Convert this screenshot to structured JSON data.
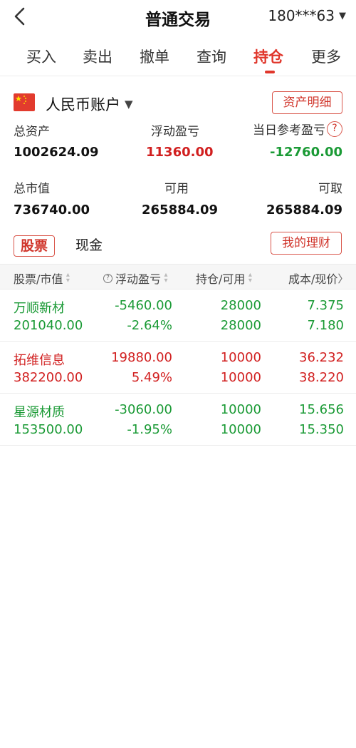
{
  "header": {
    "title": "普通交易",
    "account_masked": "180***63",
    "caret": "▼"
  },
  "tabs": [
    {
      "label": "买入"
    },
    {
      "label": "卖出"
    },
    {
      "label": "撤单"
    },
    {
      "label": "查询"
    },
    {
      "label": "持仓"
    },
    {
      "label": "更多"
    }
  ],
  "active_tab": "持仓",
  "account": {
    "currency_account": "人民币账户",
    "caret": "▼",
    "asset_detail_button": "资产明细"
  },
  "summary": {
    "total_assets_label": "总资产",
    "total_assets_value": "1002624.09",
    "floating_pl_label": "浮动盈亏",
    "floating_pl_value": "11360.00",
    "daily_ref_pl_label": "当日参考盈亏",
    "daily_ref_pl_value": "-12760.00",
    "help_symbol": "?",
    "market_value_label": "总市值",
    "market_value_value": "736740.00",
    "available_label": "可用",
    "available_value": "265884.09",
    "withdrawable_label": "可取",
    "withdrawable_value": "265884.09"
  },
  "segments": {
    "stocks_label": "股票",
    "cash_label": "现金",
    "my_wealth_button": "我的理财"
  },
  "table": {
    "headers": [
      "股票/市值",
      "浮动盈亏",
      "持仓/可用",
      "成本/现价"
    ],
    "sort_glyph": "▲▼",
    "help_glyph": "?",
    "more_glyph": "〉",
    "rows": [
      {
        "name": "万顺新材",
        "market_value": "201040.00",
        "pl": "-5460.00",
        "pl_pct": "-2.64%",
        "position": "28000",
        "available": "28000",
        "cost": "7.375",
        "price": "7.180",
        "trend": "down"
      },
      {
        "name": "拓维信息",
        "market_value": "382200.00",
        "pl": "19880.00",
        "pl_pct": "5.49%",
        "position": "10000",
        "available": "10000",
        "cost": "36.232",
        "price": "38.220",
        "trend": "up"
      },
      {
        "name": "星源材质",
        "market_value": "153500.00",
        "pl": "-3060.00",
        "pl_pct": "-1.95%",
        "position": "10000",
        "available": "10000",
        "cost": "15.656",
        "price": "15.350",
        "trend": "down"
      }
    ]
  },
  "colors": {
    "accent": "#e0362b",
    "up": "#d11f1f",
    "down": "#1a9a35"
  }
}
